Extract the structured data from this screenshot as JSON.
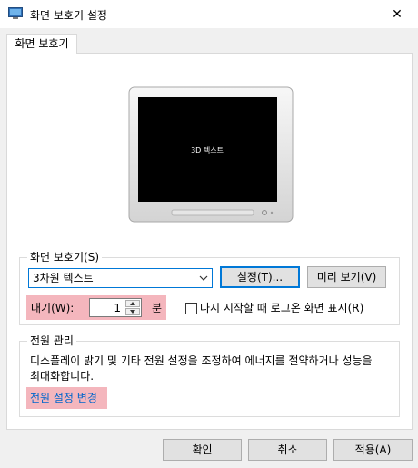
{
  "window": {
    "title": "화면 보호기 설정",
    "close_glyph": "✕"
  },
  "tabs": [
    {
      "label": "화면 보호기"
    }
  ],
  "preview": {
    "text": "3D 텍스트"
  },
  "screensaver_group": {
    "legend": "화면 보호기(S)",
    "selected": "3차원 텍스트",
    "settings_button": "설정(T)...",
    "preview_button": "미리 보기(V)",
    "wait_label": "대기(W):",
    "wait_value": "1",
    "wait_unit": "분",
    "logon_checkbox_label": "다시 시작할 때 로그온 화면 표시(R)",
    "logon_checked": false
  },
  "power_group": {
    "legend": "전원 관리",
    "description": "디스플레이 밝기 및 기타 전원 설정을 조정하여 에너지를 절약하거나 성능을 최대화합니다.",
    "link": "전원 설정 변경"
  },
  "footer": {
    "ok": "확인",
    "cancel": "취소",
    "apply": "적용(A)"
  },
  "colors": {
    "highlight": "#f4b6bd",
    "accent": "#0078d7",
    "link": "#0066cc"
  }
}
